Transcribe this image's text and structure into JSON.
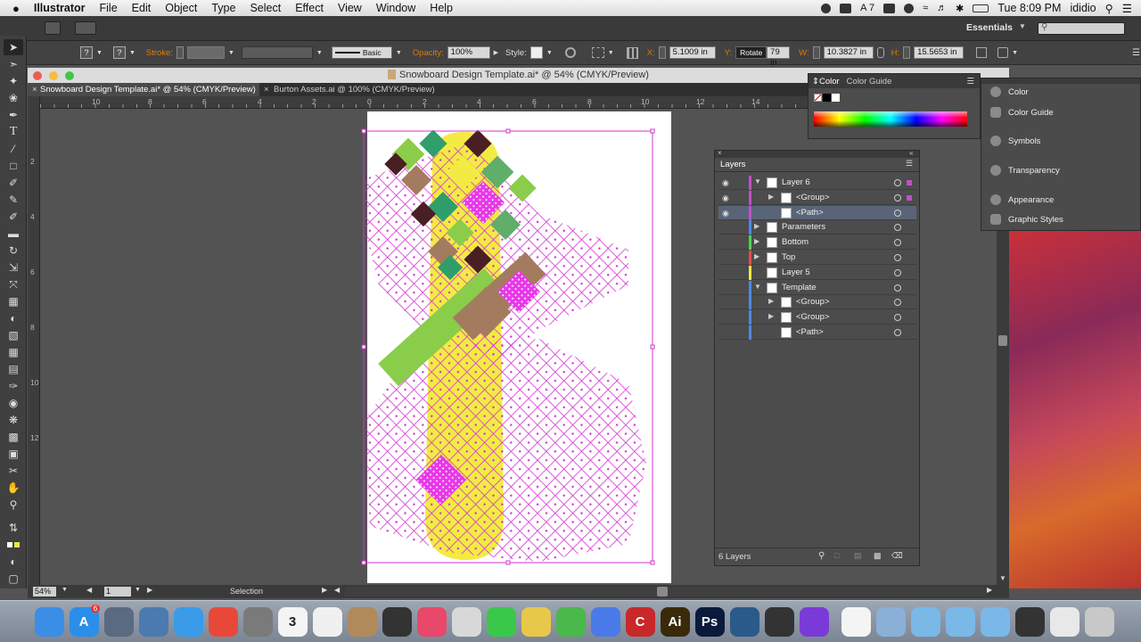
{
  "menubar": {
    "apple": "",
    "app_name": "Illustrator",
    "items": [
      "File",
      "Edit",
      "Object",
      "Type",
      "Select",
      "Effect",
      "View",
      "Window",
      "Help"
    ],
    "ai_badge": "7",
    "clock": "Tue 8:09 PM",
    "user": "ididio"
  },
  "topbar": {
    "workspace": "Essentials"
  },
  "controlbar": {
    "fill_value": "?",
    "stroke_value": "?",
    "stroke_label": "Stroke:",
    "brush_label": "Basic",
    "opacity_label": "Opacity:",
    "opacity_value": "100%",
    "style_label": "Style:",
    "x_label": "X:",
    "x_value": "5.1009 in",
    "y_label": "Y:",
    "y_value": "79 in",
    "tooltip": "Rotate",
    "w_label": "W:",
    "w_value": "10.3827 in",
    "h_label": "H:",
    "h_value": "15.5653 in"
  },
  "window": {
    "title": "Snowboard Design Template.ai* @ 54% (CMYK/Preview)"
  },
  "tabs": [
    {
      "label": "Snowboard Design Template.ai* @ 54% (CMYK/Preview)",
      "active": true
    },
    {
      "label": "Burton Assets.ai @ 100% (CMYK/Preview)",
      "active": false
    }
  ],
  "ruler_h": [
    "10",
    "8",
    "6",
    "4",
    "2",
    "0",
    "2",
    "4",
    "6",
    "8",
    "10",
    "12",
    "14"
  ],
  "ruler_v": [
    "2",
    "4",
    "6",
    "8",
    "10",
    "12"
  ],
  "status": {
    "zoom": "54%",
    "page": "1",
    "tool": "Selection"
  },
  "color_panel": {
    "tab1": "Color",
    "tab2": "Color Guide"
  },
  "layers_panel": {
    "title": "Layers",
    "rows": [
      {
        "label": "Layer 6",
        "indent": 0,
        "expanded": true,
        "color": "#c050c8"
      },
      {
        "label": "<Group>",
        "indent": 1,
        "expanded": false,
        "color": "#c050c8"
      },
      {
        "label": "<Path>",
        "indent": 1,
        "expanded": null,
        "color": "#c050c8"
      },
      {
        "label": "Parameters",
        "indent": 0,
        "expanded": false,
        "color": "#4a8ae8"
      },
      {
        "label": "Bottom",
        "indent": 0,
        "expanded": false,
        "color": "#4bd84b"
      },
      {
        "label": "Top",
        "indent": 0,
        "expanded": false,
        "color": "#e84a4a"
      },
      {
        "label": "Layer 5",
        "indent": 0,
        "expanded": null,
        "color": "#e8e84a"
      },
      {
        "label": "Template",
        "indent": 0,
        "expanded": true,
        "color": "#4a8ae8"
      },
      {
        "label": "<Group>",
        "indent": 1,
        "expanded": false,
        "color": "#4a8ae8"
      },
      {
        "label": "<Group>",
        "indent": 1,
        "expanded": false,
        "color": "#4a8ae8"
      },
      {
        "label": "<Path>",
        "indent": 1,
        "expanded": null,
        "color": "#4a8ae8"
      }
    ],
    "footer": "6 Layers"
  },
  "dock_panel": {
    "items": [
      "Color",
      "Color Guide",
      "Symbols",
      "Transparency",
      "Appearance",
      "Graphic Styles"
    ]
  },
  "dock": {
    "apps": [
      {
        "name": "finder",
        "label": "",
        "color": "#3a8ee6"
      },
      {
        "name": "appstore",
        "label": "A",
        "color": "#2b8ee8",
        "badge": "6"
      },
      {
        "name": "launchpad",
        "label": "",
        "color": "#5a6a80"
      },
      {
        "name": "preview",
        "label": "",
        "color": "#4a7ab0"
      },
      {
        "name": "safari",
        "label": "",
        "color": "#3a9be8"
      },
      {
        "name": "chrome",
        "label": "",
        "color": "#e8483a"
      },
      {
        "name": "sysprefs",
        "label": "",
        "color": "#7a7a7a"
      },
      {
        "name": "calendar",
        "label": "3",
        "color": "#f4f4f4"
      },
      {
        "name": "textedit",
        "label": "",
        "color": "#f0f0f0"
      },
      {
        "name": "contacts",
        "label": "",
        "color": "#b08a5a"
      },
      {
        "name": "aperture",
        "label": "",
        "color": "#333"
      },
      {
        "name": "itunes",
        "label": "",
        "color": "#e8486a"
      },
      {
        "name": "notes",
        "label": "",
        "color": "#d8d8d8"
      },
      {
        "name": "facetime",
        "label": "",
        "color": "#3ac84a"
      },
      {
        "name": "photos",
        "label": "",
        "color": "#e8c84a"
      },
      {
        "name": "numbers",
        "label": "",
        "color": "#4ab84a"
      },
      {
        "name": "keynote",
        "label": "",
        "color": "#4a7ae8"
      },
      {
        "name": "creative-cloud",
        "label": "C",
        "color": "#c8282a"
      },
      {
        "name": "illustrator",
        "label": "Ai",
        "color": "#3a2a0a"
      },
      {
        "name": "photoshop",
        "label": "Ps",
        "color": "#0a1a3a"
      },
      {
        "name": "quicktime",
        "label": "",
        "color": "#2a5a8a"
      },
      {
        "name": "finalcut",
        "label": "",
        "color": "#333"
      },
      {
        "name": "imovie",
        "label": "",
        "color": "#7a3ad8"
      },
      {
        "name": "download",
        "label": "",
        "color": "#f4f4f4"
      },
      {
        "name": "folder-1",
        "label": "",
        "color": "#8ab0d8"
      },
      {
        "name": "folder-2",
        "label": "",
        "color": "#7ab8e8"
      },
      {
        "name": "folder-3",
        "label": "",
        "color": "#7ab8e8"
      },
      {
        "name": "folder-4",
        "label": "",
        "color": "#7ab8e8"
      },
      {
        "name": "display",
        "label": "",
        "color": "#333"
      },
      {
        "name": "document-stack",
        "label": "",
        "color": "#e8e8e8"
      },
      {
        "name": "trash",
        "label": "",
        "color": "#c8c8c8"
      }
    ]
  }
}
